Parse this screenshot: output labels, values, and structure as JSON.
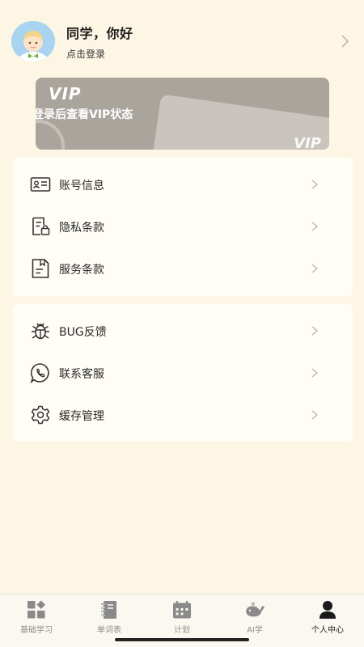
{
  "profile": {
    "greeting": "同学，你好",
    "login_hint": "点击登录"
  },
  "vip": {
    "logo": "VIP",
    "status": "登录后查看VIP状态",
    "corner": "VIP"
  },
  "menu_group_1": [
    {
      "label": "账号信息",
      "icon": "id-card-icon"
    },
    {
      "label": "隐私条款",
      "icon": "privacy-lock-icon"
    },
    {
      "label": "服务条款",
      "icon": "document-icon"
    }
  ],
  "menu_group_2": [
    {
      "label": "BUG反馈",
      "icon": "bug-icon"
    },
    {
      "label": "联系客服",
      "icon": "phone-icon"
    },
    {
      "label": "缓存管理",
      "icon": "gear-icon"
    }
  ],
  "tabs": [
    {
      "label": "基础学习",
      "icon": "grid-icon"
    },
    {
      "label": "单词表",
      "icon": "notebook-icon"
    },
    {
      "label": "计划",
      "icon": "calendar-icon"
    },
    {
      "label": "AI学",
      "icon": "whale-icon"
    },
    {
      "label": "个人中心",
      "icon": "person-icon",
      "active": true
    }
  ],
  "colors": {
    "background": "#fdf6e4",
    "card": "#fffdf6",
    "vip_card": "#a9a49c",
    "tab_active": "#1a1a1a",
    "tab_inactive": "#8c8c8c"
  }
}
